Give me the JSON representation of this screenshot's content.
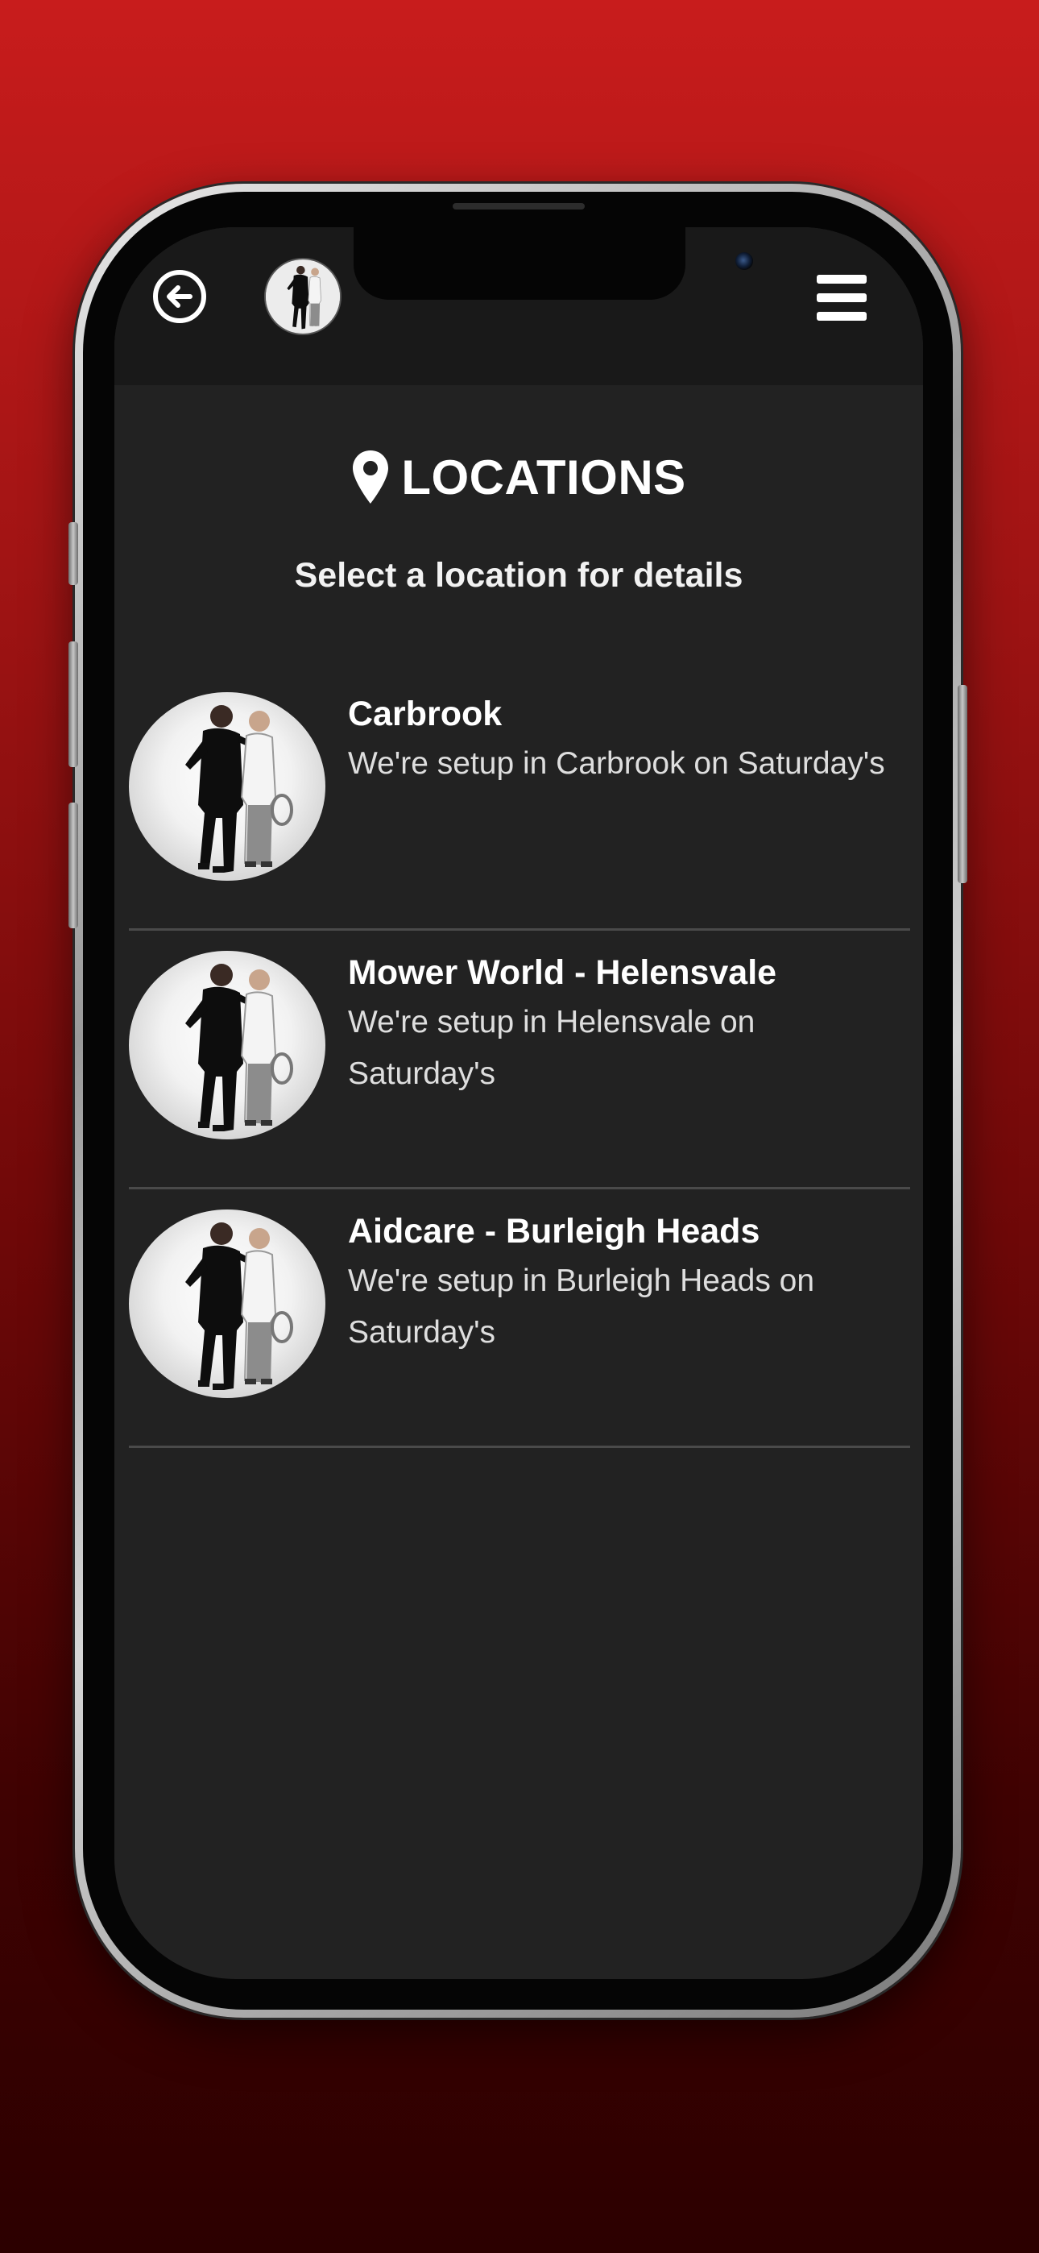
{
  "header": {
    "back_icon": "back-arrow-circle-icon",
    "avatar_icon": "profile-avatar",
    "menu_icon": "hamburger-menu-icon"
  },
  "page": {
    "title_icon": "map-pin-icon",
    "title": "LOCATIONS",
    "subtitle": "Select a location for details"
  },
  "locations": [
    {
      "name": "Carbrook",
      "description": "We're setup in Carbrook on Saturday's"
    },
    {
      "name": "Mower World - Helensvale",
      "description": "We're setup in Helensvale on Saturday's"
    },
    {
      "name": "Aidcare - Burleigh Heads",
      "description": "We're setup in Burleigh Heads on Saturday's"
    }
  ],
  "colors": {
    "background_top": "#c81c1c",
    "background_bottom": "#2c0000",
    "screen": "#222222",
    "header": "#191919",
    "text": "#ffffff",
    "divider": "#4a4a4a"
  }
}
